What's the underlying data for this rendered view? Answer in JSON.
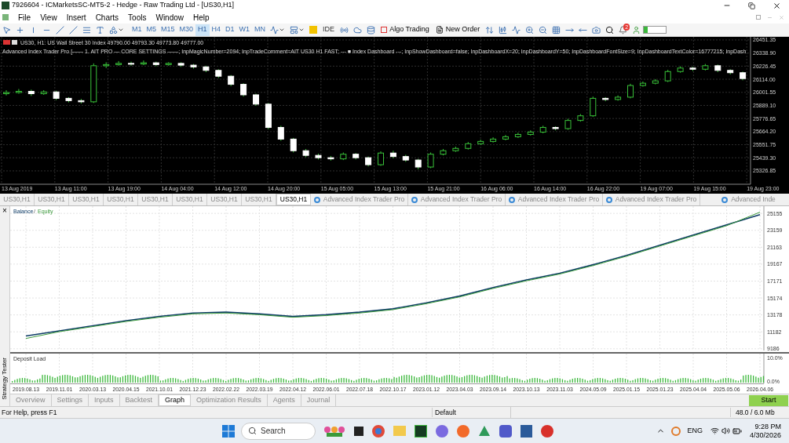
{
  "window": {
    "title": "7926604 - ICMarketsSC-MT5-2 - Hedge - Raw Trading Ltd - [US30,H1]"
  },
  "menu": [
    "File",
    "View",
    "Insert",
    "Charts",
    "Tools",
    "Window",
    "Help"
  ],
  "toolbar": {
    "timeframes": [
      {
        "label": "M1",
        "selected": false
      },
      {
        "label": "M5",
        "selected": false
      },
      {
        "label": "M15",
        "selected": false
      },
      {
        "label": "M30",
        "selected": false
      },
      {
        "label": "H1",
        "selected": true
      },
      {
        "label": "H4",
        "selected": false
      },
      {
        "label": "D1",
        "selected": false
      },
      {
        "label": "W1",
        "selected": false
      },
      {
        "label": "MN",
        "selected": false
      }
    ],
    "ide": "IDE",
    "algo_trading": "Algo Trading",
    "new_order": "New Order",
    "notification_count": "2"
  },
  "chart": {
    "time_labels": [
      "13 Aug 2019",
      "13 Aug 11:00",
      "13 Aug 19:00",
      "14 Aug 04:00",
      "14 Aug 12:00",
      "14 Aug 20:00",
      "15 Aug 05:00",
      "15 Aug 13:00",
      "15 Aug 21:00",
      "16 Aug 06:00",
      "16 Aug 14:00",
      "16 Aug 22:00",
      "19 Aug 07:00",
      "19 Aug 15:00",
      "19 Aug 23:00"
    ],
    "symbol_line": "US30, H1:  US Wall Street 30 Index  49790.00 49793.30 49773.80 49777.00",
    "ea_line": "Advanced Index Trader Pro [—— 1. AIT PRO — CORE SETTINGS ——; InpMagicNumber=2094; InpTradeComment=AIT US30 H1 FAST; --- ■ Index Dashboard ---; InpShowDashboard=false; InpDashboardX=20; InpDashboardY=50; InpDashboardFontSize=9; InpDashboardTextColor=16777215; InpDash",
    "chart_data": {
      "type": "candlestick",
      "grid": true,
      "ylim": [
        25212,
        26478
      ],
      "yticks": [
        {
          "value": 26451.35,
          "label": "26451.35"
        },
        {
          "value": 26338.9,
          "label": "26338.90"
        },
        {
          "value": 26226.45,
          "label": "26226.45"
        },
        {
          "value": 26114,
          "label": "26114.00"
        },
        {
          "value": 26001.55,
          "label": "26001.55"
        },
        {
          "value": 25889.1,
          "label": "25889.10"
        },
        {
          "value": 25776.65,
          "label": "25776.65"
        },
        {
          "value": 25664.2,
          "label": "25664.20"
        },
        {
          "value": 25551.75,
          "label": "25551.75"
        },
        {
          "value": 25439.3,
          "label": "25439.30"
        },
        {
          "value": 25326.85,
          "label": "25326.85"
        }
      ],
      "ohlc": [
        [
          25990,
          26020,
          25975,
          26000
        ],
        [
          26000,
          26030,
          25990,
          26010
        ],
        [
          26010,
          26025,
          25970,
          25990
        ],
        [
          25990,
          26020,
          25980,
          26005
        ],
        [
          26005,
          26015,
          25935,
          25950
        ],
        [
          25950,
          25960,
          25915,
          25930
        ],
        [
          25930,
          25945,
          25905,
          25920
        ],
        [
          25920,
          26250,
          25910,
          26230
        ],
        [
          26230,
          26260,
          26210,
          26240
        ],
        [
          26240,
          26270,
          26230,
          26250
        ],
        [
          26250,
          26265,
          26230,
          26245
        ],
        [
          26245,
          26275,
          26235,
          26255
        ],
        [
          26255,
          26265,
          26225,
          26240
        ],
        [
          26240,
          26260,
          26230,
          26250
        ],
        [
          26250,
          26260,
          26220,
          26235
        ],
        [
          26235,
          26245,
          26205,
          26220
        ],
        [
          26220,
          26230,
          26175,
          26190
        ],
        [
          26190,
          26200,
          26125,
          26140
        ],
        [
          26140,
          26150,
          26055,
          26070
        ],
        [
          26070,
          26080,
          25965,
          25980
        ],
        [
          25980,
          25990,
          25885,
          25900
        ],
        [
          25900,
          25910,
          25685,
          25700
        ],
        [
          25700,
          25715,
          25585,
          25600
        ],
        [
          25600,
          25610,
          25485,
          25500
        ],
        [
          25500,
          25515,
          25445,
          25460
        ],
        [
          25460,
          25475,
          25425,
          25440
        ],
        [
          25440,
          25455,
          25415,
          25430
        ],
        [
          25430,
          25485,
          25420,
          25470
        ],
        [
          25470,
          25480,
          25425,
          25440
        ],
        [
          25440,
          25450,
          25365,
          25380
        ],
        [
          25380,
          25495,
          25370,
          25480
        ],
        [
          25480,
          25500,
          25435,
          25450
        ],
        [
          25450,
          25465,
          25405,
          25420
        ],
        [
          25420,
          25430,
          25340,
          25360
        ],
        [
          25360,
          25485,
          25350,
          25470
        ],
        [
          25470,
          25515,
          25460,
          25500
        ],
        [
          25500,
          25535,
          25490,
          25520
        ],
        [
          25520,
          25575,
          25510,
          25560
        ],
        [
          25560,
          25595,
          25550,
          25580
        ],
        [
          25580,
          25615,
          25570,
          25600
        ],
        [
          25600,
          25635,
          25590,
          25620
        ],
        [
          25620,
          25655,
          25610,
          25640
        ],
        [
          25640,
          25675,
          25630,
          25660
        ],
        [
          25660,
          25715,
          25650,
          25700
        ],
        [
          25700,
          25710,
          25675,
          25690
        ],
        [
          25690,
          25775,
          25680,
          25760
        ],
        [
          25760,
          25815,
          25750,
          25800
        ],
        [
          25800,
          25965,
          25790,
          25950
        ],
        [
          25950,
          25960,
          25925,
          25940
        ],
        [
          25940,
          25975,
          25930,
          25960
        ],
        [
          25960,
          26075,
          25950,
          26060
        ],
        [
          26060,
          26095,
          26050,
          26080
        ],
        [
          26080,
          26115,
          26070,
          26100
        ],
        [
          26100,
          26195,
          26090,
          26180
        ],
        [
          26180,
          26225,
          26170,
          26210
        ],
        [
          26210,
          26220,
          26185,
          26200
        ],
        [
          26200,
          26245,
          26190,
          26230
        ],
        [
          26230,
          26240,
          26175,
          26190
        ],
        [
          26190,
          26200,
          26155,
          26170
        ],
        [
          26170,
          26180,
          26105,
          26120
        ]
      ]
    }
  },
  "chart_tabs": [
    {
      "label": "US30,H1",
      "kind": "symbol",
      "selected": false
    },
    {
      "label": "US30,H1",
      "kind": "symbol",
      "selected": false
    },
    {
      "label": "US30,H1",
      "kind": "symbol",
      "selected": false
    },
    {
      "label": "US30,H1",
      "kind": "symbol",
      "selected": false
    },
    {
      "label": "US30,H1",
      "kind": "symbol",
      "selected": false
    },
    {
      "label": "US30,H1",
      "kind": "symbol",
      "selected": false
    },
    {
      "label": "US30,H1",
      "kind": "symbol",
      "selected": false
    },
    {
      "label": "US30,H1",
      "kind": "symbol",
      "selected": false
    },
    {
      "label": "US30,H1",
      "kind": "symbol",
      "selected": true
    },
    {
      "label": "Advanced Index Trader Pro",
      "kind": "expert",
      "selected": false
    },
    {
      "label": "Advanced Index Trader Pro",
      "kind": "expert",
      "selected": false
    },
    {
      "label": "Advanced Index Trader Pro",
      "kind": "expert",
      "selected": false
    },
    {
      "label": "Advanced Index Trader Pro",
      "kind": "expert",
      "selected": false
    },
    {
      "label": "Advanced Inde",
      "kind": "expert",
      "selected": false
    }
  ],
  "tester": {
    "side_title": "Strategy Tester",
    "close": "×",
    "legend_separator": "/",
    "chart_data": {
      "type": "line",
      "grid": true,
      "x": [
        "2019.08.13",
        "2019.11.01",
        "2020.03.13",
        "2020.04.15",
        "2021.10.01",
        "2021.12.23",
        "2022.02.22",
        "2022.03.19",
        "2022.04.12",
        "2022.06.01",
        "2022.07.18",
        "2022.10.17",
        "2023.01.12",
        "2023.04.03",
        "2023.09.14",
        "2023.10.13",
        "2023.11.03",
        "2024.05.09",
        "2025.01.15",
        "2025.01.23",
        "2025.04.04",
        "2025.05.06",
        "2026.04.06"
      ],
      "series": [
        {
          "name": "Balance",
          "color": "#0d3b66",
          "values": [
            10700,
            11300,
            11900,
            12500,
            13000,
            13400,
            13500,
            13300,
            13000,
            13200,
            13500,
            13900,
            14600,
            15400,
            16400,
            17300,
            18100,
            19100,
            20200,
            21400,
            22600,
            23800,
            25000
          ]
        },
        {
          "name": "Equity",
          "color": "#3c9a3c",
          "values": [
            10400,
            11200,
            11800,
            12400,
            12900,
            13300,
            13400,
            13200,
            12900,
            13100,
            13400,
            13800,
            14500,
            15300,
            16300,
            17200,
            18000,
            19000,
            20100,
            21300,
            22500,
            23700,
            25300
          ]
        }
      ],
      "ylim": [
        5100,
        26000
      ],
      "yticks": [
        9186,
        11182,
        13178,
        15174,
        17171,
        19167,
        21163,
        23159,
        25155
      ]
    },
    "deposit_load": {
      "title": "Deposit Load",
      "y_labels": [
        "10.0%",
        "0.0%"
      ]
    },
    "tabs": [
      {
        "label": "Overview",
        "selected": false
      },
      {
        "label": "Settings",
        "selected": false
      },
      {
        "label": "Inputs",
        "selected": false
      },
      {
        "label": "Backtest",
        "selected": false
      },
      {
        "label": "Graph",
        "selected": true
      },
      {
        "label": "Optimization Results",
        "selected": false
      },
      {
        "label": "Agents",
        "selected": false
      },
      {
        "label": "Journal",
        "selected": false
      }
    ],
    "start": "Start"
  },
  "status_bar": {
    "help": "For Help, press F1",
    "profile": "Default",
    "traffic": "48.0 / 6.0 Mb"
  },
  "taskbar": {
    "search_placeholder": "Search",
    "language": "ENG",
    "time": "9:28 PM",
    "date": "4/30/2026"
  }
}
